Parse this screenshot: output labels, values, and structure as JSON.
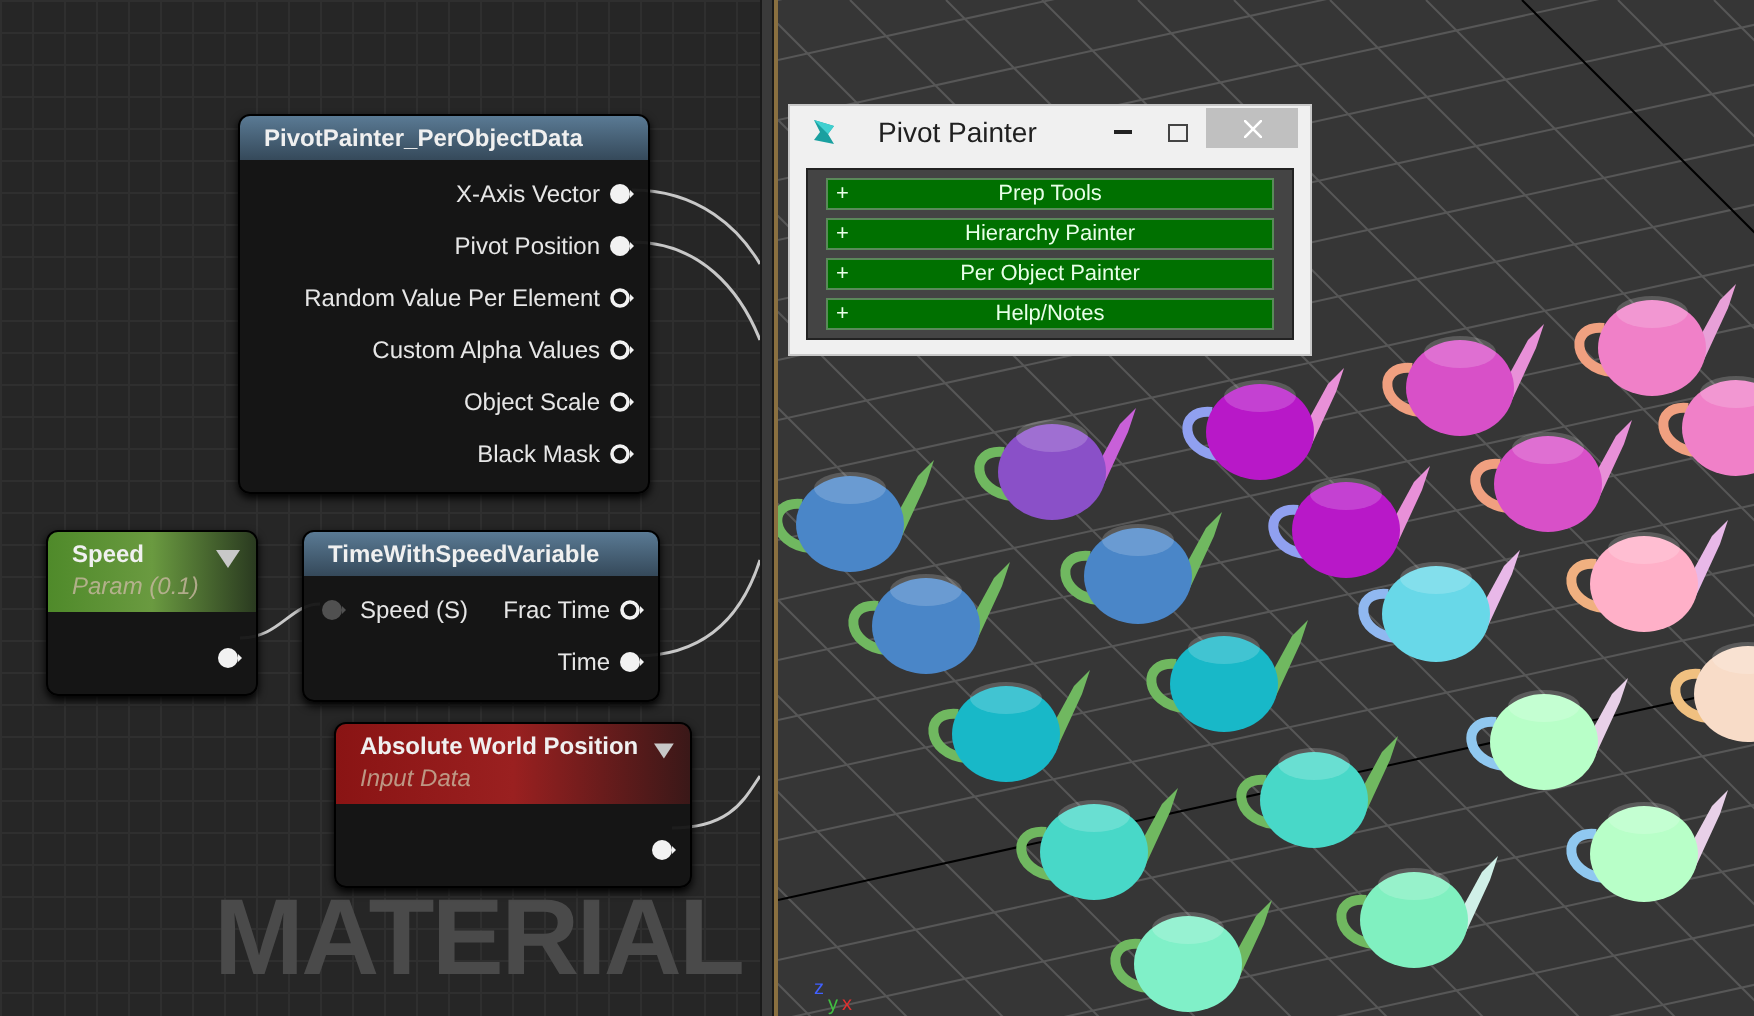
{
  "graph": {
    "watermark": "MATERIAL",
    "nodes": [
      {
        "kind": "function",
        "title": "PivotPainter_PerObjectData",
        "outputs": [
          {
            "label": "X-Axis Vector",
            "connected": true
          },
          {
            "label": "Pivot Position",
            "connected": true
          },
          {
            "label": "Random Value Per Element",
            "connected": false
          },
          {
            "label": "Custom Alpha Values",
            "connected": false
          },
          {
            "label": "Object Scale",
            "connected": false
          },
          {
            "label": "Black Mask",
            "connected": false
          }
        ]
      },
      {
        "kind": "parameter",
        "title": "Speed",
        "subtitle": "Param (0.1)",
        "outputs": [
          {
            "connected": true
          }
        ]
      },
      {
        "kind": "function",
        "title": "TimeWithSpeedVariable",
        "inputs": [
          {
            "label": "Speed (S)",
            "connected": true
          }
        ],
        "outputs": [
          {
            "label": "Frac Time",
            "connected": false
          },
          {
            "label": "Time",
            "connected": true
          }
        ]
      },
      {
        "kind": "input",
        "title": "Absolute World Position",
        "subtitle": "Input Data",
        "outputs": [
          {
            "connected": true
          }
        ]
      }
    ]
  },
  "dialog": {
    "title": "Pivot Painter",
    "rollouts": [
      {
        "sign": "+",
        "label": "Prep Tools"
      },
      {
        "sign": "+",
        "label": "Hierarchy Painter"
      },
      {
        "sign": "+",
        "label": "Per Object Painter"
      },
      {
        "sign": "+",
        "label": "Help/Notes"
      }
    ]
  },
  "viewport": {
    "axes": [
      "z",
      "y",
      "x"
    ]
  }
}
